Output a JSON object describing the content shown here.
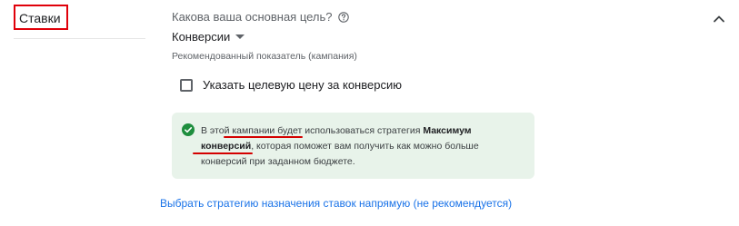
{
  "section": {
    "title": "Ставки"
  },
  "goal": {
    "question": "Какова ваша основная цель?",
    "selected_value": "Конверсии",
    "recommended_metric_label": "Рекомендованный показатель (кампания)"
  },
  "target_cost": {
    "checkbox_label": "Указать целевую цену за конверсию",
    "checked": false
  },
  "info": {
    "text_before": "В этой кампании будет использоваться стратегия ",
    "strategy_name": "Максимум конверсий",
    "text_after": ", которая поможет вам получить как можно больше конверсий при заданном бюджете."
  },
  "links": {
    "choose_strategy": "Выбрать стратегию назначения ставок напрямую (не рекомендуется)"
  },
  "icons": {
    "help": "help-circle-icon",
    "collapse": "chevron-up-icon",
    "dropdown": "caret-down-icon",
    "success": "check-circle-icon"
  },
  "colors": {
    "highlight_red": "#e0000a",
    "info_background": "#e8f3ea",
    "success_green": "#1e8e3e",
    "link_blue": "#1a73e8"
  }
}
